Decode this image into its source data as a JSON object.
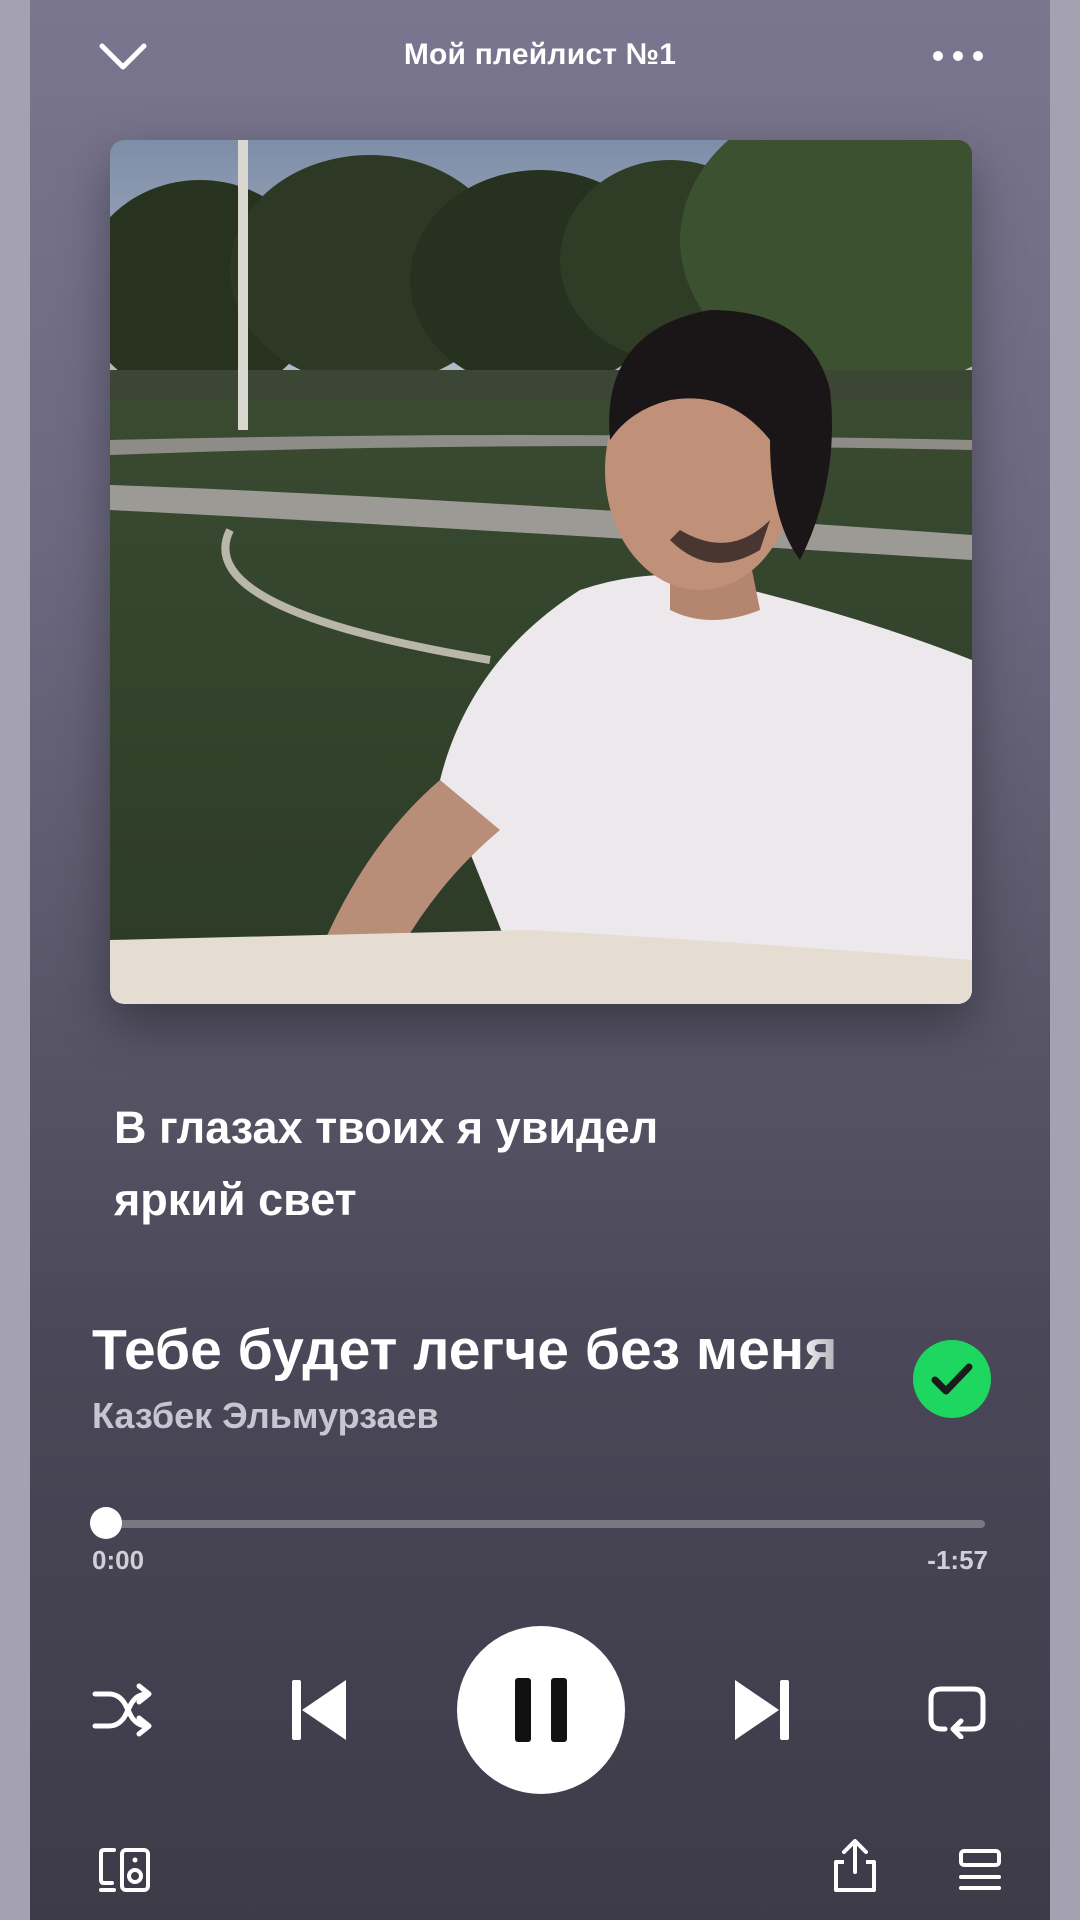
{
  "header": {
    "playlist_title": "Мой плейлист №1"
  },
  "lyrics": {
    "line1": "В глазах твоих я увидел",
    "line2": "яркий свет"
  },
  "track": {
    "title": "Тебе будет легче без меня",
    "artist": "Казбек Эльмурзаев",
    "liked": true
  },
  "progress": {
    "elapsed": "0:00",
    "remaining": "-1:57",
    "fraction": 0.0
  },
  "colors": {
    "accent": "#1ed760",
    "background_top": "#7a7690",
    "background_bottom": "#3d3b48"
  },
  "icons": {
    "collapse": "chevron-down-icon",
    "more": "more-options-icon",
    "liked": "check-icon",
    "shuffle": "shuffle-icon",
    "previous": "skip-previous-icon",
    "pause": "pause-icon",
    "next": "skip-next-icon",
    "repeat": "repeat-icon",
    "devices": "connect-device-icon",
    "share": "share-icon",
    "queue": "queue-icon"
  }
}
